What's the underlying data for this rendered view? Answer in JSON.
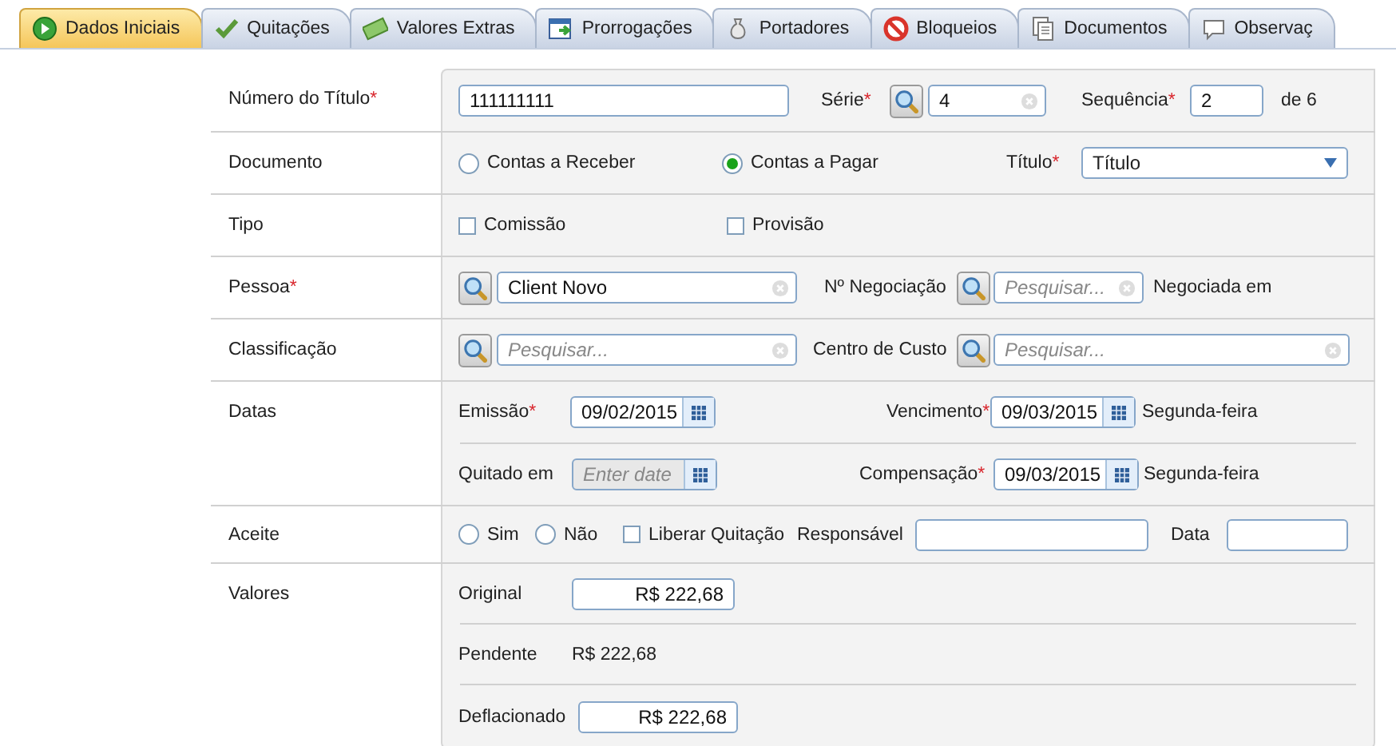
{
  "tabs": [
    {
      "label": "Dados Iniciais",
      "selected": true
    },
    {
      "label": "Quitações",
      "selected": false
    },
    {
      "label": "Valores Extras",
      "selected": false
    },
    {
      "label": "Prorrogações",
      "selected": false
    },
    {
      "label": "Portadores",
      "selected": false
    },
    {
      "label": "Bloqueios",
      "selected": false
    },
    {
      "label": "Documentos",
      "selected": false
    },
    {
      "label": "Observaç",
      "selected": false
    }
  ],
  "form": {
    "rows": [
      {
        "label": "Número do Título",
        "mark": "*",
        "lines": [
          [
            {
              "kind": "input",
              "value": "111111111"
            },
            {
              "kind": "label",
              "text": "Série",
              "mark": "*"
            },
            {
              "kind": "lookup"
            },
            {
              "kind": "search",
              "value": "4"
            },
            {
              "kind": "label",
              "text": "Sequência",
              "mark": "*"
            },
            {
              "kind": "input",
              "value": "2"
            },
            {
              "kind": "label",
              "text": "de 6"
            }
          ]
        ]
      },
      {
        "label": "Documento",
        "lines": [
          [
            {
              "kind": "radio",
              "text": "Contas a Receber",
              "selected": false
            },
            {
              "kind": "radio",
              "text": "Contas a Pagar",
              "selected": true
            },
            {
              "kind": "label",
              "text": "Título",
              "mark": "*"
            },
            {
              "kind": "select",
              "value": "Título"
            }
          ]
        ]
      },
      {
        "label": "Tipo",
        "lines": [
          [
            {
              "kind": "checkbox",
              "text": "Comissão",
              "checked": false
            },
            {
              "kind": "checkbox",
              "text": "Provisão",
              "checked": false
            }
          ]
        ]
      },
      {
        "label": "Pessoa",
        "mark": "*",
        "lines": [
          [
            {
              "kind": "lookup"
            },
            {
              "kind": "search",
              "value": "Client Novo"
            },
            {
              "kind": "label",
              "text": "Nº Negociação"
            },
            {
              "kind": "lookup"
            },
            {
              "kind": "search",
              "placeholder": "Pesquisar..."
            },
            {
              "kind": "label",
              "text": "Negociada em"
            }
          ]
        ]
      },
      {
        "label": "Classificação",
        "lines": [
          [
            {
              "kind": "lookup"
            },
            {
              "kind": "search",
              "placeholder": "Pesquisar..."
            },
            {
              "kind": "label",
              "text": "Centro de Custo"
            },
            {
              "kind": "lookup"
            },
            {
              "kind": "search",
              "placeholder": "Pesquisar..."
            }
          ]
        ]
      },
      {
        "label": "Datas",
        "lines": [
          [
            {
              "kind": "label",
              "text": "Emissão",
              "mark": "*"
            },
            {
              "kind": "date",
              "value": "09/02/2015",
              "disabled": false
            },
            {
              "kind": "label",
              "text": "Vencimento",
              "mark": "*"
            },
            {
              "kind": "date",
              "value": "09/03/2015",
              "disabled": false
            },
            {
              "kind": "label",
              "text": "Segunda-feira"
            }
          ],
          [
            {
              "kind": "label",
              "text": "Quitado em"
            },
            {
              "kind": "date",
              "placeholder": "Enter date",
              "disabled": true
            },
            {
              "kind": "label",
              "text": "Compensação",
              "mark": "*"
            },
            {
              "kind": "date",
              "value": "09/03/2015",
              "disabled": false
            },
            {
              "kind": "label",
              "text": "Segunda-feira"
            }
          ]
        ]
      },
      {
        "label": "Aceite",
        "lines": [
          [
            {
              "kind": "radio",
              "text": "Sim",
              "selected": false
            },
            {
              "kind": "radio",
              "text": "Não",
              "selected": false
            },
            {
              "kind": "checkbox",
              "text": "Liberar Quitação",
              "checked": false
            },
            {
              "kind": "label",
              "text": "Responsável"
            },
            {
              "kind": "input"
            },
            {
              "kind": "label",
              "text": "Data"
            },
            {
              "kind": "input"
            }
          ]
        ]
      },
      {
        "label": "Valores",
        "lines": [
          [
            {
              "kind": "label",
              "text": "Original"
            },
            {
              "kind": "amount",
              "value": "R$ 222,68"
            }
          ],
          [
            {
              "kind": "label",
              "text": "Pendente"
            },
            {
              "kind": "label",
              "text": "R$ 222,68"
            }
          ],
          [
            {
              "kind": "label",
              "text": "Deflacionado"
            },
            {
              "kind": "amount",
              "value": "R$ 222,68"
            }
          ]
        ]
      }
    ]
  }
}
